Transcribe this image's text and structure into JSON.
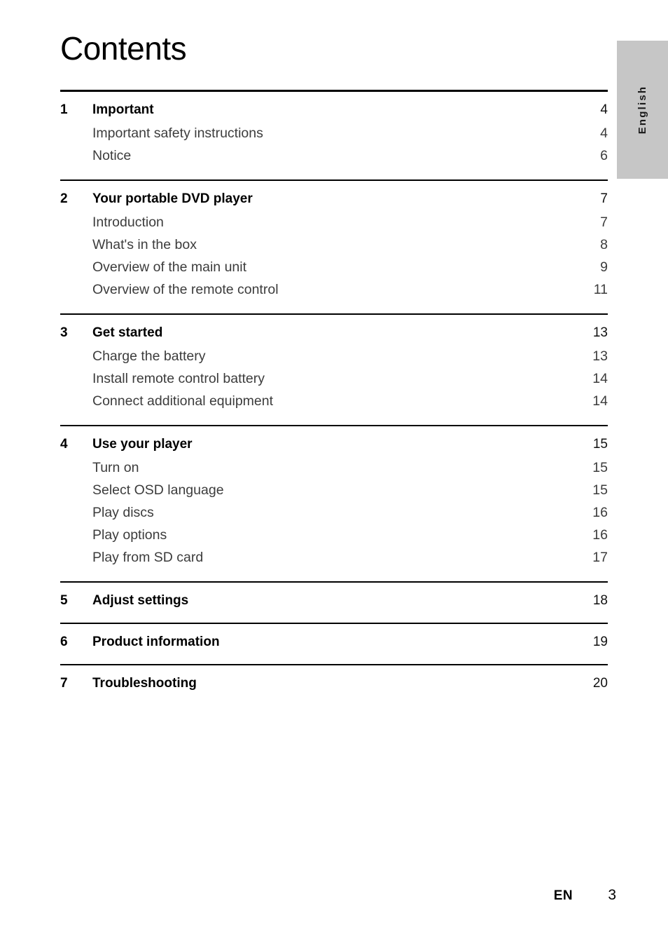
{
  "page": {
    "title": "Contents",
    "side_tab_label": "English",
    "side_tab_color": "#c6c6c6"
  },
  "toc": {
    "sections": [
      {
        "number": "1",
        "title": "Important",
        "page": "4",
        "entries": [
          {
            "label": "Important safety instructions",
            "page": "4"
          },
          {
            "label": "Notice",
            "page": "6"
          }
        ]
      },
      {
        "number": "2",
        "title": "Your portable DVD player",
        "page": "7",
        "entries": [
          {
            "label": "Introduction",
            "page": "7"
          },
          {
            "label": "What's in the box",
            "page": "8"
          },
          {
            "label": "Overview of the main unit",
            "page": "9"
          },
          {
            "label": "Overview of the remote control",
            "page": "11"
          }
        ]
      },
      {
        "number": "3",
        "title": "Get started",
        "page": "13",
        "entries": [
          {
            "label": "Charge the battery",
            "page": "13"
          },
          {
            "label": "Install remote control battery",
            "page": "14"
          },
          {
            "label": "Connect additional equipment",
            "page": "14"
          }
        ]
      },
      {
        "number": "4",
        "title": "Use your player",
        "page": "15",
        "entries": [
          {
            "label": "Turn on",
            "page": "15"
          },
          {
            "label": "Select OSD language",
            "page": "15"
          },
          {
            "label": "Play discs",
            "page": "16"
          },
          {
            "label": "Play options",
            "page": "16"
          },
          {
            "label": "Play from SD card",
            "page": "17"
          }
        ]
      },
      {
        "number": "5",
        "title": "Adjust settings",
        "page": "18",
        "entries": []
      },
      {
        "number": "6",
        "title": "Product information",
        "page": "19",
        "entries": []
      },
      {
        "number": "7",
        "title": "Troubleshooting",
        "page": "20",
        "entries": []
      }
    ]
  },
  "footer": {
    "language_code": "EN",
    "page_number": "3"
  }
}
